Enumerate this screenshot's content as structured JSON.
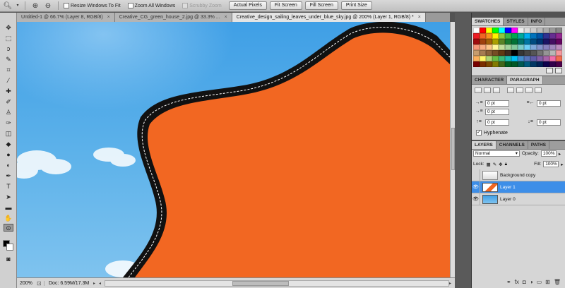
{
  "options_bar": {
    "tool_icon": "zoom-icon",
    "resize_windows_label": "Resize Windows To Fit",
    "zoom_all_windows_label": "Zoom All Windows",
    "scrubby_zoom_label": "Scrubby Zoom",
    "actual_pixels_label": "Actual Pixels",
    "fit_screen_label": "Fit Screen",
    "fill_screen_label": "Fill Screen",
    "print_size_label": "Print Size"
  },
  "tabs": [
    {
      "label": "Untitled-1 @ 66.7% (Layer 8, RGB/8)",
      "close": "×"
    },
    {
      "label": "Creative_CG_green_house_2.jpg @ 33.3% ...",
      "close": "×"
    },
    {
      "label": "Creative_design_sailing_leaves_under_blue_sky.jpg @ 200% (Layer 1, RGB/8) *",
      "close": "×"
    }
  ],
  "status_bar": {
    "zoom": "200%",
    "doc": "Doc: 6.59M/17.3M"
  },
  "swatches_panel": {
    "tabs": [
      "SWATCHES",
      "STYLES",
      "INFO"
    ],
    "colors": [
      "#ffffff",
      "#ff0000",
      "#ffff00",
      "#00ff00",
      "#00ffff",
      "#0000ff",
      "#ff00ff",
      "#eeeeee",
      "#dddddd",
      "#cccccc",
      "#bbbbbb",
      "#aaaaaa",
      "#999999",
      "#888888",
      "#ed1c24",
      "#f26522",
      "#f7941d",
      "#fff200",
      "#8dc63f",
      "#39b54a",
      "#00a651",
      "#00a99d",
      "#00aeef",
      "#0072bc",
      "#0054a6",
      "#2e3192",
      "#662d91",
      "#92278f",
      "#9e0b0f",
      "#a0410d",
      "#a3620a",
      "#aba000",
      "#598527",
      "#197b30",
      "#007236",
      "#00746b",
      "#0076a3",
      "#004b80",
      "#003471",
      "#1b1464",
      "#440e62",
      "#630460",
      "#f69679",
      "#f9ad81",
      "#fdc689",
      "#fff799",
      "#c4df9b",
      "#a3d39c",
      "#82ca9c",
      "#7accc8",
      "#6dcff6",
      "#7da7d9",
      "#8393ca",
      "#8781bd",
      "#a187be",
      "#bd8cbf",
      "#c69c6d",
      "#a67c52",
      "#8c6239",
      "#754c24",
      "#603913",
      "#3d2b1f",
      "#000000",
      "#363636",
      "#464646",
      "#555555",
      "#737373",
      "#959595",
      "#b7b7b7",
      "#f5989d",
      "#fbaf5d",
      "#fff568",
      "#acd373",
      "#68bd45",
      "#3cb878",
      "#1cbbb4",
      "#00bff3",
      "#448ccb",
      "#5674b9",
      "#605ca8",
      "#855fa8",
      "#a864a8",
      "#f06eaa",
      "#f26c4f",
      "#790000",
      "#7b2e00",
      "#7d4900",
      "#827b00",
      "#406618",
      "#005e20",
      "#005826",
      "#005952",
      "#005b7f",
      "#003663",
      "#002157",
      "#0d004c",
      "#32004b",
      "#4b0049"
    ]
  },
  "paragraph_panel": {
    "tabs": [
      "CHARACTER",
      "PARAGRAPH"
    ],
    "indent_left": "0 pt",
    "indent_right": "0 pt",
    "indent_first": "0 pt",
    "space_before": "0 pt",
    "space_after": "0 pt",
    "hyphenate_label": "Hyphenate"
  },
  "layers_panel": {
    "tabs": [
      "LAYERS",
      "CHANNELS",
      "PATHS"
    ],
    "blend_mode": "Normal",
    "opacity_label": "Opacity:",
    "opacity_value": "100%",
    "lock_label": "Lock:",
    "fill_label": "Fill:",
    "fill_value": "100%",
    "layers": [
      {
        "name": "Background copy",
        "visible": false,
        "selected": false
      },
      {
        "name": "Layer 1",
        "visible": true,
        "selected": true
      },
      {
        "name": "Layer 0",
        "visible": true,
        "selected": false
      }
    ]
  }
}
